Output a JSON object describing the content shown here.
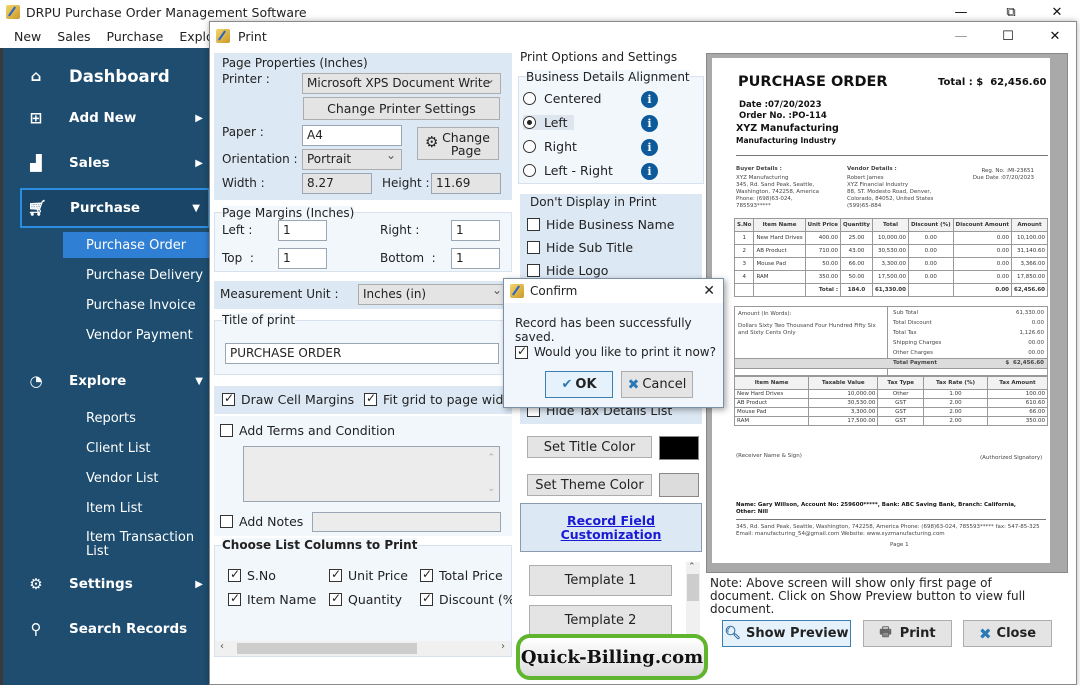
{
  "app": {
    "title": "DRPU Purchase Order Management Software",
    "window_controls": {
      "minimize": "—",
      "restore": "⧉",
      "close": "✕"
    }
  },
  "menu": [
    "New",
    "Sales",
    "Purchase",
    "Explore"
  ],
  "sidebar": {
    "items": [
      {
        "label": "Dashboard",
        "icon": "home-icon"
      },
      {
        "label": "Add New",
        "icon": "add-document-icon"
      },
      {
        "label": "Sales",
        "icon": "sales-chart-icon"
      },
      {
        "label": "Purchase",
        "icon": "cart-icon"
      },
      {
        "label": "Explore",
        "icon": "pie-chart-icon"
      },
      {
        "label": "Settings",
        "icon": "gear-icon"
      },
      {
        "label": "Search Records",
        "icon": "search-icon"
      }
    ],
    "purchase_sub": [
      "Purchase Order",
      "Purchase Delivery",
      "Purchase Invoice",
      "Vendor Payment"
    ],
    "explore_sub": [
      "Reports",
      "Client List",
      "Vendor List",
      "Item List",
      "Item Transaction List"
    ],
    "active_sub": "Purchase Order"
  },
  "print_dialog": {
    "title": "Print",
    "page_properties": {
      "heading": "Page Properties (Inches)",
      "printer_label": "Printer :",
      "printer_value": "Microsoft XPS Document Write",
      "change_printer_btn": "Change Printer Settings",
      "paper_label": "Paper :",
      "paper_value": "A4",
      "change_page_btn": "Change Page",
      "orientation_label": "Orientation :",
      "orientation_value": "Portrait",
      "width_label": "Width :",
      "width_value": "8.27",
      "height_label": "Height :",
      "height_value": "11.69"
    },
    "margins": {
      "heading": "Page Margins (Inches)",
      "left_label": "Left :",
      "left_value": "1",
      "right_label": "Right :",
      "right_value": "1",
      "top_label": "Top  :",
      "top_value": "1",
      "bottom_label": "Bottom  :",
      "bottom_value": "1"
    },
    "measurement": {
      "label": "Measurement Unit :",
      "value": "Inches (in)"
    },
    "title_of_print": {
      "heading": "Title of print",
      "value": "PURCHASE ORDER"
    },
    "draw_cell_margins": {
      "label": "Draw Cell Margins",
      "checked": true
    },
    "fit_grid": {
      "label": "Fit grid to page width",
      "checked": true
    },
    "add_terms": {
      "label": "Add Terms and Condition",
      "checked": false
    },
    "add_notes": {
      "label": "Add Notes",
      "checked": false
    },
    "list_columns": {
      "heading": "Choose List Columns to Print",
      "columns": [
        {
          "label": "S.No",
          "checked": true
        },
        {
          "label": "Unit Price",
          "checked": true
        },
        {
          "label": "Total Price",
          "checked": true
        },
        {
          "label": "Item Name",
          "checked": true
        },
        {
          "label": "Quantity",
          "checked": true
        },
        {
          "label": "Discount (%",
          "checked": true
        }
      ]
    },
    "print_options": {
      "heading": "Print Options and Settings",
      "alignment_heading": "Business Details Alignment",
      "alignments": [
        "Centered",
        "Left",
        "Right",
        "Left - Right"
      ],
      "selected_alignment": "Left",
      "dont_display_heading": "Don't Display in Print",
      "hide_options": [
        "Hide Business Name",
        "Hide Sub Title",
        "Hide Logo",
        "Hide Tax Details List"
      ],
      "set_title_color_btn": "Set Title Color",
      "title_color": "#000000",
      "set_theme_color_btn": "Set Theme Color",
      "theme_color": "#dcdcdc",
      "record_field_link": "Record Field Customization",
      "templates": [
        "Template 1",
        "Template 2"
      ]
    },
    "note": "Note: Above screen will show only first page of document. Click on Show Preview button to view full document.",
    "buttons": {
      "show_preview": "Show Preview",
      "print": "Print",
      "close": "Close"
    }
  },
  "preview": {
    "title": "PURCHASE ORDER",
    "total": "Total : $  62,456.60",
    "date": "Date :07/20/2023",
    "order_no": "Order No. :PO-114",
    "business_name": "XYZ Manufacturing",
    "business_sub": "Manufacturing Industry",
    "buyer_heading": "Buyer Details :",
    "buyer_lines": [
      "XYZ Manufacturing",
      "345, Rd. Sand Peak, Seattle,",
      "Washington, 742258, America",
      "Phone: (698)63-024,",
      "785593*****"
    ],
    "vendor_heading": "Vendor Details :",
    "vendor_lines": [
      "Robert James",
      "XYZ Financial Industry",
      "88, ST. Modesto Road, Denver,",
      "Colorado, 84052, United States",
      "(599)65-884"
    ],
    "reg_no": "Reg. No. :MI-23651",
    "due_date": "Due Date :07/20/2023",
    "items_headers": [
      "S.No",
      "Item Name",
      "Unit Price",
      "Quantity",
      "Total",
      "Discount (%)",
      "Discount Amount",
      "Amount"
    ],
    "items": [
      [
        "1",
        "New Hard Drives",
        "400.00",
        "25.00",
        "10,000.00",
        "0.00",
        "0.00",
        "10,100.00"
      ],
      [
        "2",
        "AB Product",
        "710.00",
        "43.00",
        "30,530.00",
        "0.00",
        "0.00",
        "31,140.60"
      ],
      [
        "3",
        "Mouse Pad",
        "50.00",
        "66.00",
        "3,300.00",
        "0.00",
        "0.00",
        "3,366.00"
      ],
      [
        "4",
        "RAM",
        "350.00",
        "50.00",
        "17,500.00",
        "0.00",
        "0.00",
        "17,850.00"
      ]
    ],
    "items_total": {
      "label": "Total :",
      "quantity": "184.0",
      "total": "61,330.00",
      "discount_amount": "0.00",
      "amount": "62,456.60"
    },
    "amount_words_label": "Amount (In Words):",
    "amount_words": "Dollars Sixty Two Thousand Four Hundred Fifty Six and Sixty Cents Only",
    "summary": [
      [
        "Sub Total",
        "61,330.00"
      ],
      [
        "Total Discount",
        "0.00"
      ],
      [
        "Total Tax",
        "1,126.60"
      ],
      [
        "Shipping Charges",
        "00.00"
      ],
      [
        "Other Charges",
        "00.00"
      ]
    ],
    "total_payment": [
      "Total Payment",
      "$  62,456.60"
    ],
    "tax_headers": [
      "Item Name",
      "Taxable Value",
      "Tax Type",
      "Tax Rate (%)",
      "Tax Amount"
    ],
    "tax_rows": [
      [
        "New Hard Drives",
        "10,000.00",
        "Other",
        "1.00",
        "100.00"
      ],
      [
        "AB Product",
        "30,530.00",
        "GST",
        "2.00",
        "610.60"
      ],
      [
        "Mouse Pad",
        "3,300.00",
        "GST",
        "2.00",
        "66.00"
      ],
      [
        "RAM",
        "17,500.00",
        "GST",
        "2.00",
        "350.00"
      ]
    ],
    "receiver_sign": "(Receiver Name & Sign)",
    "authorized_sign": "(Authorized Signatory)",
    "bank_details": "Name: Gary Willson, Account No: 259600*****, Bank: ABC Saving Bank, Branch: California, Other: Nill",
    "footer_address": "345, Rd. Sand Peak, Seattle, Washington, 742258, America  Phone: (698)63-024, 785593*****  fax: 547-85-325  Email: manufacturing_54@gmail.com  Website: www.xyzmanufacturing.com",
    "page": "Page 1"
  },
  "confirm": {
    "title": "Confirm",
    "message": "Record has been successfully saved.",
    "print_now": {
      "label": "Would you like to print it now?",
      "checked": true
    },
    "ok": "OK",
    "cancel": "Cancel"
  },
  "watermark": "Quick-Billing.com"
}
